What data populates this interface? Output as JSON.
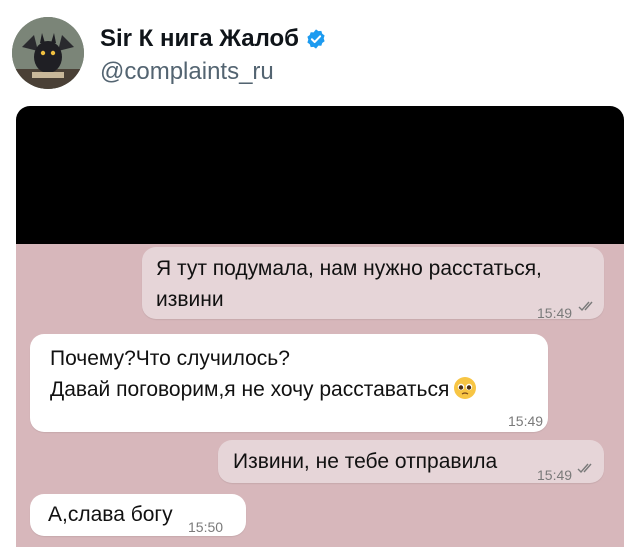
{
  "tweet": {
    "display_name": "Sir К нига Жалоб",
    "handle": "@complaints_ru",
    "verified_icon": "verified-badge-icon",
    "verified_color": "#1d9bf0"
  },
  "chat": {
    "background_color": "#d7b7bb",
    "messages": [
      {
        "direction": "outgoing",
        "lines": [
          "Я тут подумала, нам нужно расстаться,",
          "извини"
        ],
        "time": "15:49",
        "status_icon": "double-check-icon"
      },
      {
        "direction": "incoming",
        "lines": [
          "Почему?Что случилось?",
          "Давай поговорим,я не хочу расставаться"
        ],
        "emoji": "pleading-face-icon",
        "time": "15:49"
      },
      {
        "direction": "outgoing",
        "lines": [
          "Извини, не тебе отправила"
        ],
        "time": "15:49",
        "status_icon": "double-check-icon"
      },
      {
        "direction": "incoming",
        "lines": [
          "А,слава богу"
        ],
        "time": "15:50"
      }
    ]
  }
}
